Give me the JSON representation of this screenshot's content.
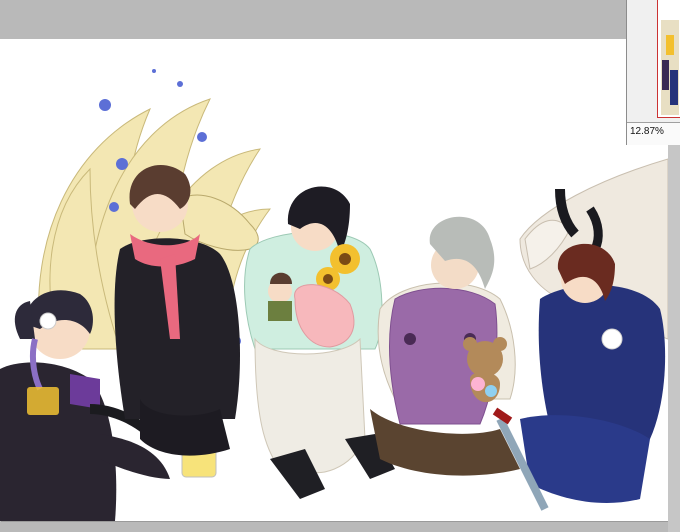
{
  "navigator": {
    "zoom_level": "12.87%"
  },
  "colors": {
    "workspace": "#b9b9b9",
    "canvas": "#ffffff",
    "fox_tails": "#f3e7b3",
    "petals": "#5c6fd6",
    "navy_uniform": "#26337a",
    "pink_scarf": "#e9697f",
    "mint_jacket": "#cfeee0",
    "purple_cushion": "#9a6aa8"
  },
  "icons": {
    "zoom": "magnifier-icon"
  }
}
